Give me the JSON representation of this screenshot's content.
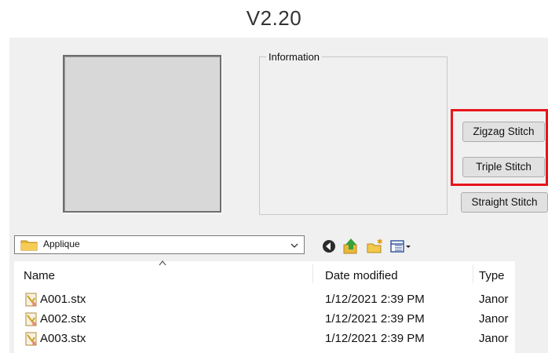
{
  "version": "V2.20",
  "info_panel": {
    "label": "Information"
  },
  "buttons": {
    "zigzag": "Zigzag Stitch",
    "triple": "Triple Stitch",
    "straight": "Straight Stitch"
  },
  "highlight_color": "#e8151b",
  "folder": {
    "current": "Applique",
    "icon": "folder-icon"
  },
  "toolbar": {
    "icons": [
      "back-icon",
      "up-folder-icon",
      "new-folder-icon",
      "view-menu-icon"
    ]
  },
  "file_list": {
    "sort_indicator": "^",
    "columns": [
      "Name",
      "Date modified",
      "Type"
    ],
    "rows": [
      {
        "name": "A001.stx",
        "date": "1/12/2021 2:39 PM",
        "type": "Janor"
      },
      {
        "name": "A002.stx",
        "date": "1/12/2021 2:39 PM",
        "type": "Janor"
      },
      {
        "name": "A003.stx",
        "date": "1/12/2021 2:39 PM",
        "type": "Janor"
      }
    ]
  }
}
